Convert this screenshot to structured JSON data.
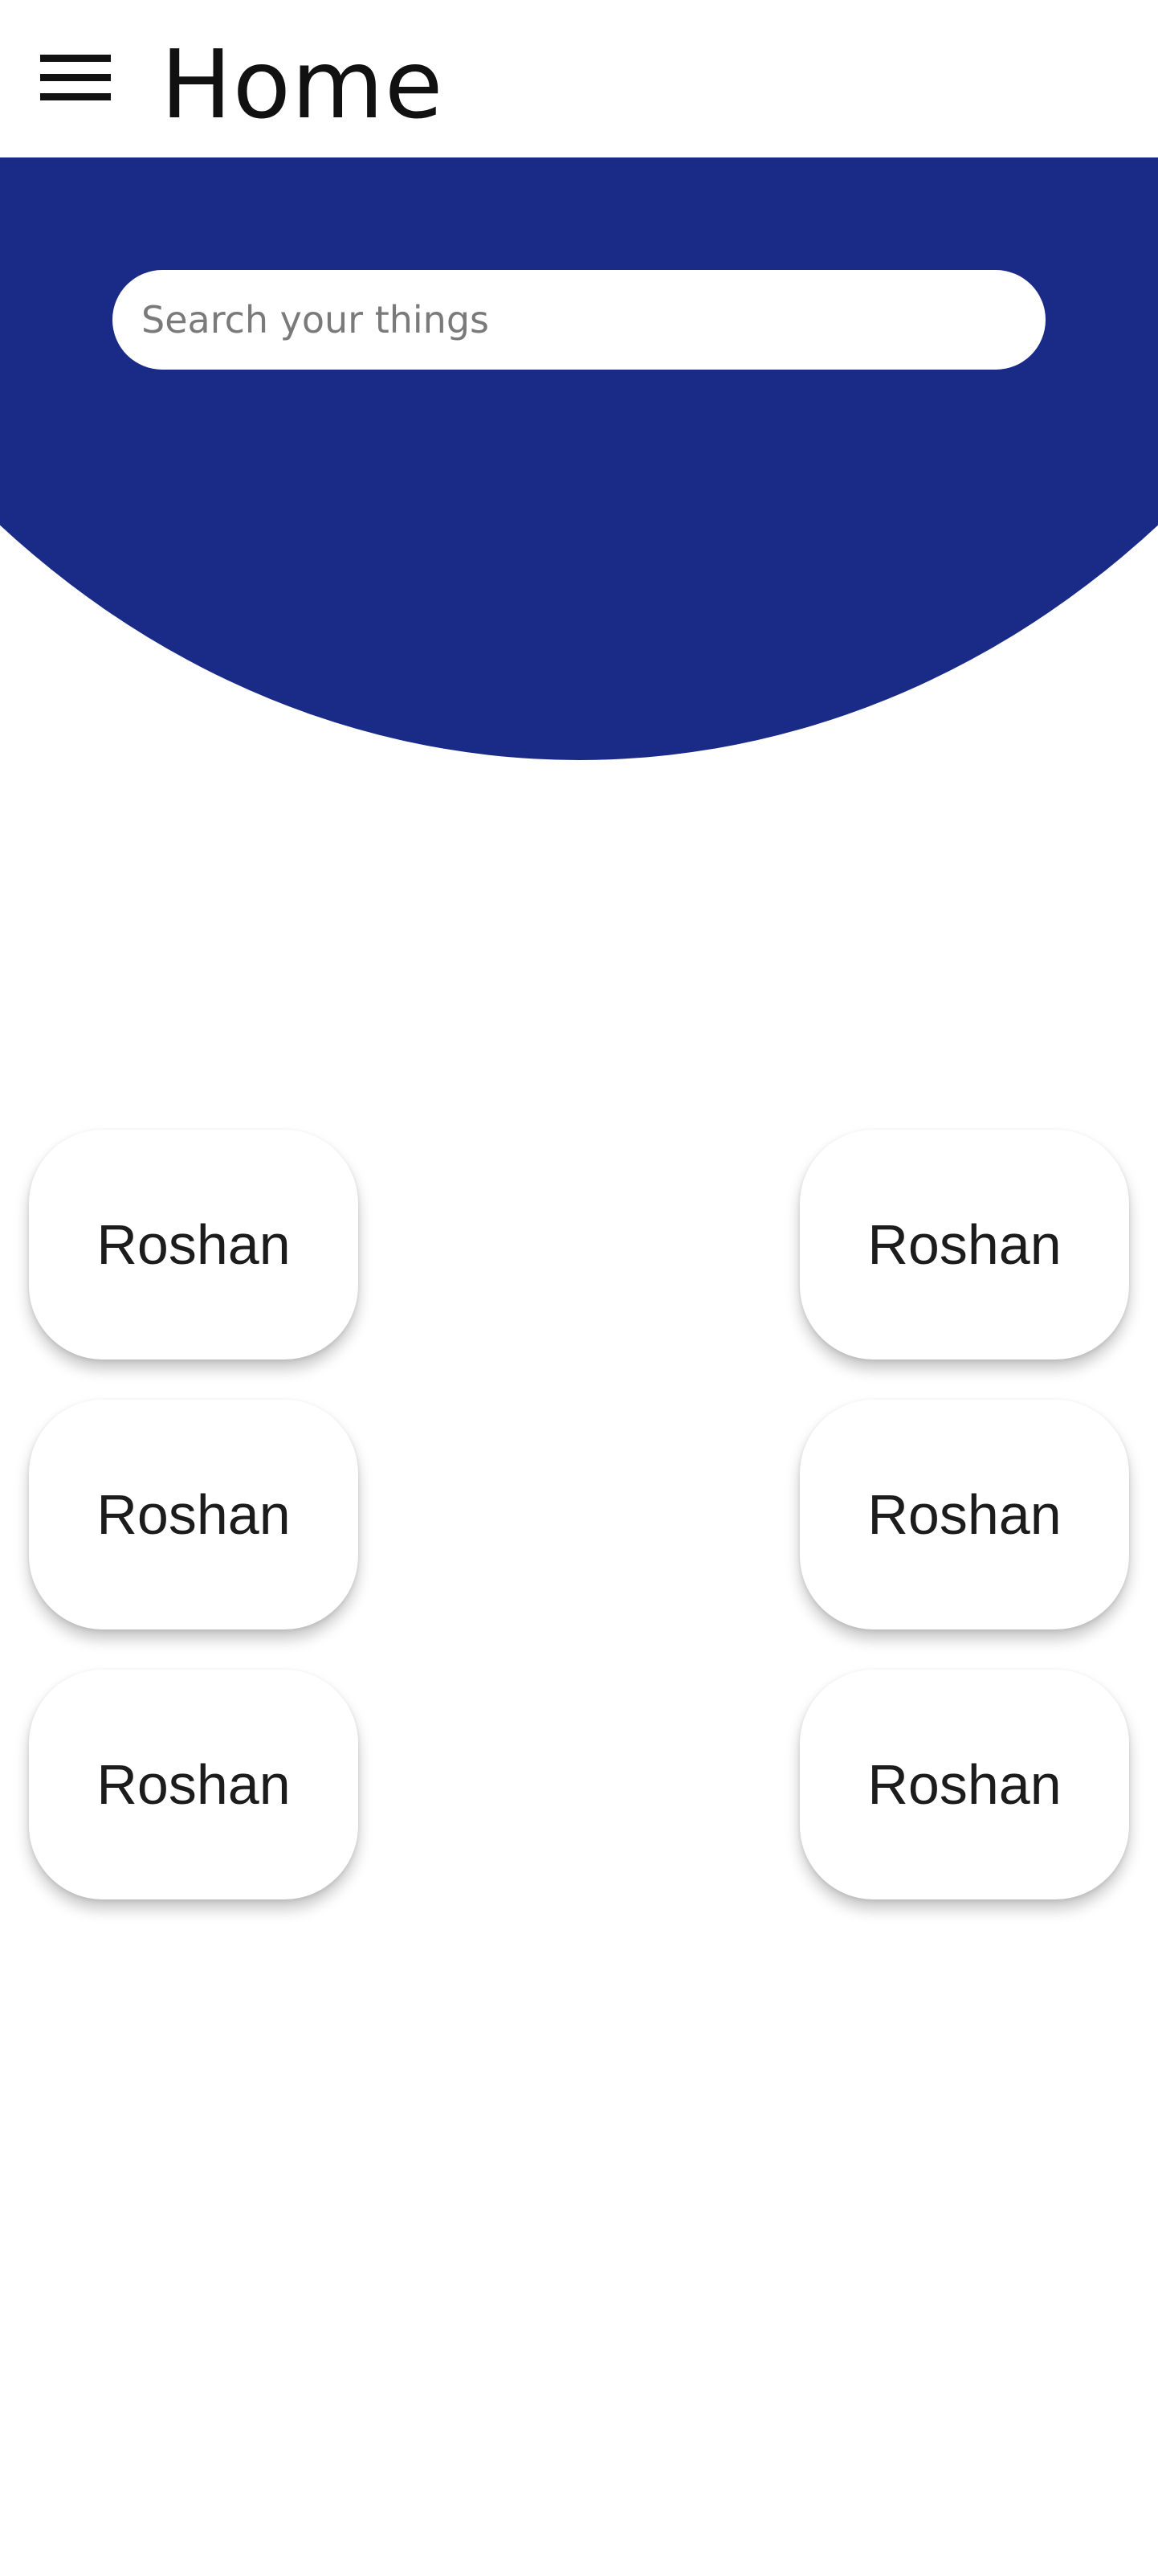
{
  "appbar": {
    "title": "Home",
    "menu_icon": "hamburger-menu-icon"
  },
  "search": {
    "placeholder": "Search your things",
    "value": ""
  },
  "colors": {
    "banner": "#1a2a87",
    "background": "#ffffff"
  },
  "cards": [
    {
      "label": "Roshan"
    },
    {
      "label": "Roshan"
    },
    {
      "label": "Roshan"
    },
    {
      "label": "Roshan"
    },
    {
      "label": "Roshan"
    },
    {
      "label": "Roshan"
    }
  ]
}
